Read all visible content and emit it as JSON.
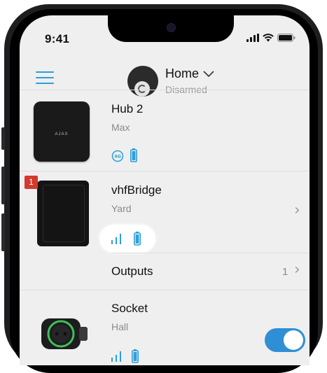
{
  "status_bar": {
    "time": "9:41"
  },
  "header": {
    "hub_name": "Home",
    "mode": "Disarmed"
  },
  "devices": [
    {
      "name": "Hub 2",
      "room": "Max",
      "image_text": "AJAX",
      "icons": [
        "4g-icon",
        "battery-icon"
      ]
    },
    {
      "name": "vhfBridge",
      "room": "Yard",
      "badge": "1",
      "icons": [
        "signal-icon",
        "battery-icon"
      ]
    },
    {
      "name": "Socket",
      "room": "Hall",
      "toggle_on": true,
      "icons": [
        "signal-icon",
        "battery-icon"
      ]
    }
  ],
  "outputs": {
    "label": "Outputs",
    "count": "1"
  },
  "colors": {
    "accent": "#2e9fd9",
    "badge": "#d13a2c",
    "background": "#efefef",
    "toggle": "#2e8fd6"
  }
}
